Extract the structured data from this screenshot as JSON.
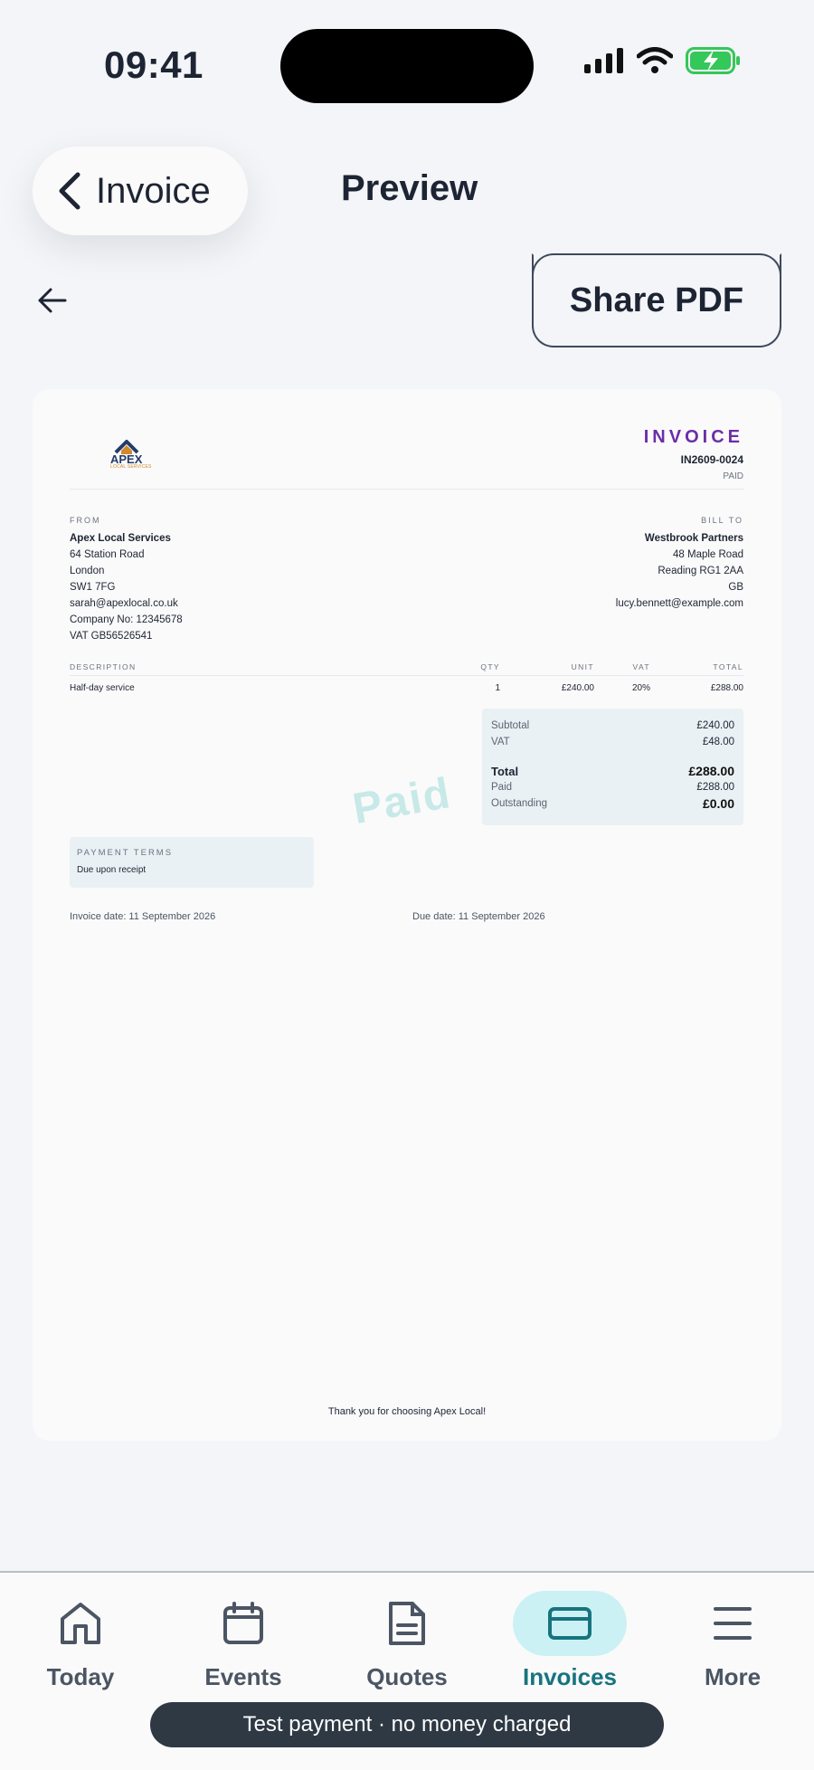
{
  "status_bar": {
    "time": "09:41"
  },
  "header": {
    "back_label": "Invoice",
    "title": "Preview",
    "share_label": "Share PDF"
  },
  "invoice": {
    "logo_word": "APEX",
    "logo_sub": "LOCAL SERVICES",
    "doc_title": "INVOICE",
    "number": "IN2609-0024",
    "status": "PAID",
    "from": {
      "caption": "FROM",
      "name": "Apex Local Services",
      "lines": [
        "64 Station Road",
        "London",
        "SW1 7FG",
        "sarah@apexlocal.co.uk",
        "Company No: 12345678",
        "VAT GB56526541"
      ]
    },
    "bill_to": {
      "caption": "BILL TO",
      "name": "Westbrook Partners",
      "lines": [
        "48 Maple Road",
        "Reading RG1 2AA",
        "GB",
        "lucy.bennett@example.com"
      ]
    },
    "table": {
      "headers": [
        "DESCRIPTION",
        "QTY",
        "UNIT",
        "VAT",
        "TOTAL"
      ],
      "rows": [
        [
          "Half-day service",
          "1",
          "£240.00",
          "20%",
          "£288.00"
        ]
      ]
    },
    "totals": {
      "subtotal_label": "Subtotal",
      "subtotal": "£240.00",
      "vat_label": "VAT",
      "vat": "£48.00",
      "total_label": "Total",
      "total": "£288.00",
      "paid_label": "Paid",
      "paid": "£288.00",
      "outstanding_label": "Outstanding",
      "outstanding": "£0.00"
    },
    "watermark": "Paid",
    "terms": {
      "caption": "PAYMENT TERMS",
      "text": "Due upon receipt"
    },
    "invoice_date": "Invoice date: 11 September 2026",
    "due_date": "Due date: 11 September 2026",
    "thanks": "Thank you for choosing Apex Local!"
  },
  "nav": {
    "items": [
      {
        "label": "Today",
        "icon": "home-icon"
      },
      {
        "label": "Events",
        "icon": "calendar-icon"
      },
      {
        "label": "Quotes",
        "icon": "document-icon"
      },
      {
        "label": "Invoices",
        "icon": "card-icon",
        "active": true
      },
      {
        "label": "More",
        "icon": "menu-icon"
      }
    ]
  },
  "toast": "Test payment · no money charged",
  "colors": {
    "accent": "#17747f",
    "invoice_title": "#6b2ea7",
    "active_pill": "#cbf1f4",
    "battery": "#34c759"
  }
}
